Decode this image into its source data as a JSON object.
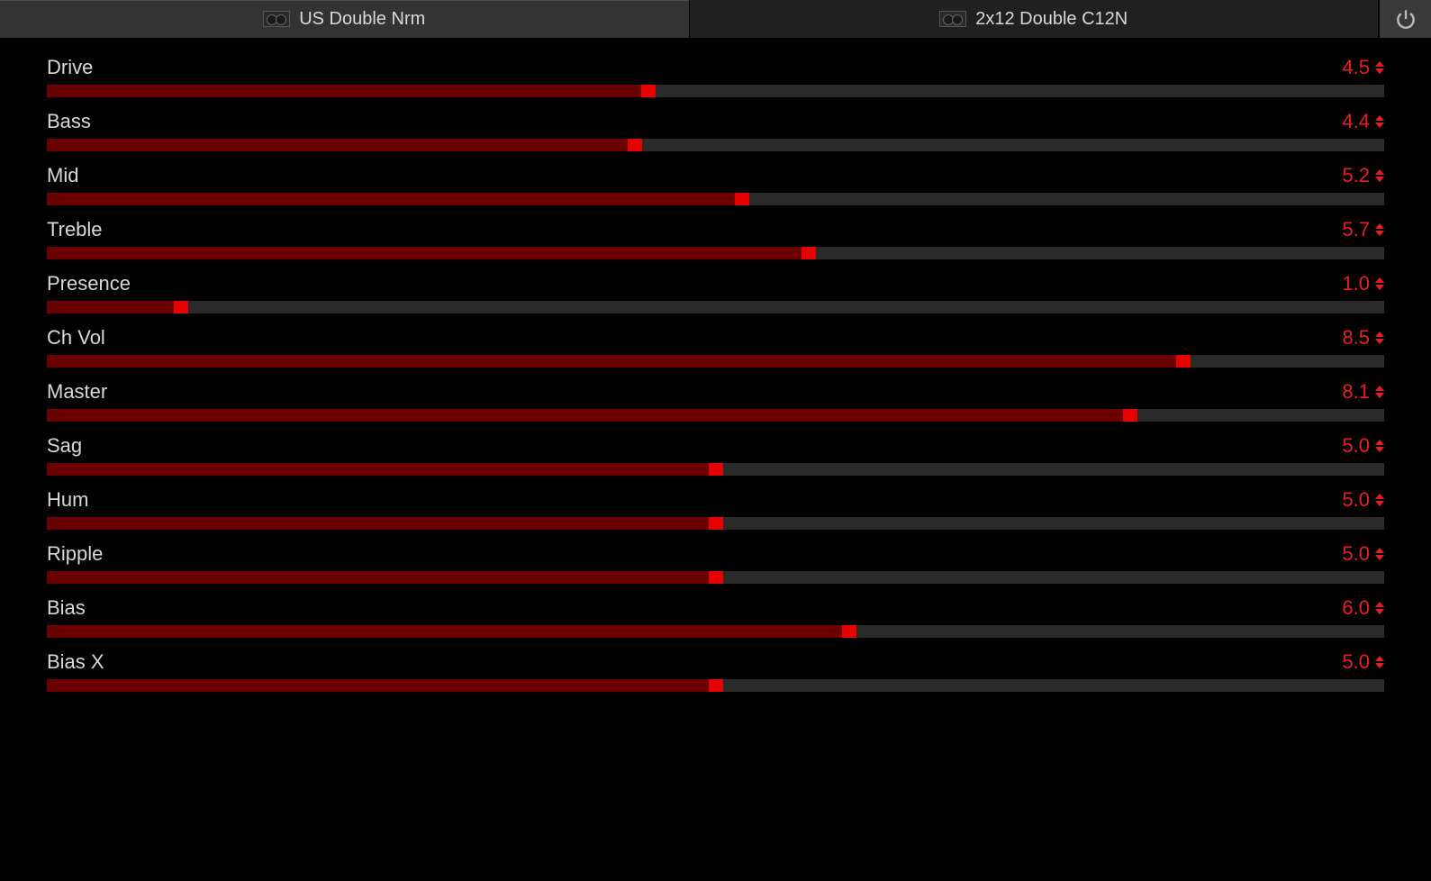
{
  "header": {
    "tabs": [
      {
        "label": "US Double Nrm",
        "active": true
      },
      {
        "label": "2x12 Double C12N",
        "active": false
      }
    ]
  },
  "params": [
    {
      "label": "Drive",
      "value": "4.5",
      "min": 0,
      "max": 10,
      "num": 4.5
    },
    {
      "label": "Bass",
      "value": "4.4",
      "min": 0,
      "max": 10,
      "num": 4.4
    },
    {
      "label": "Mid",
      "value": "5.2",
      "min": 0,
      "max": 10,
      "num": 5.2
    },
    {
      "label": "Treble",
      "value": "5.7",
      "min": 0,
      "max": 10,
      "num": 5.7
    },
    {
      "label": "Presence",
      "value": "1.0",
      "min": 0,
      "max": 10,
      "num": 1.0
    },
    {
      "label": "Ch Vol",
      "value": "8.5",
      "min": 0,
      "max": 10,
      "num": 8.5
    },
    {
      "label": "Master",
      "value": "8.1",
      "min": 0,
      "max": 10,
      "num": 8.1
    },
    {
      "label": "Sag",
      "value": "5.0",
      "min": 0,
      "max": 10,
      "num": 5.0
    },
    {
      "label": "Hum",
      "value": "5.0",
      "min": 0,
      "max": 10,
      "num": 5.0
    },
    {
      "label": "Ripple",
      "value": "5.0",
      "min": 0,
      "max": 10,
      "num": 5.0
    },
    {
      "label": "Bias",
      "value": "6.0",
      "min": 0,
      "max": 10,
      "num": 6.0
    },
    {
      "label": "Bias X",
      "value": "5.0",
      "min": 0,
      "max": 10,
      "num": 5.0
    }
  ]
}
